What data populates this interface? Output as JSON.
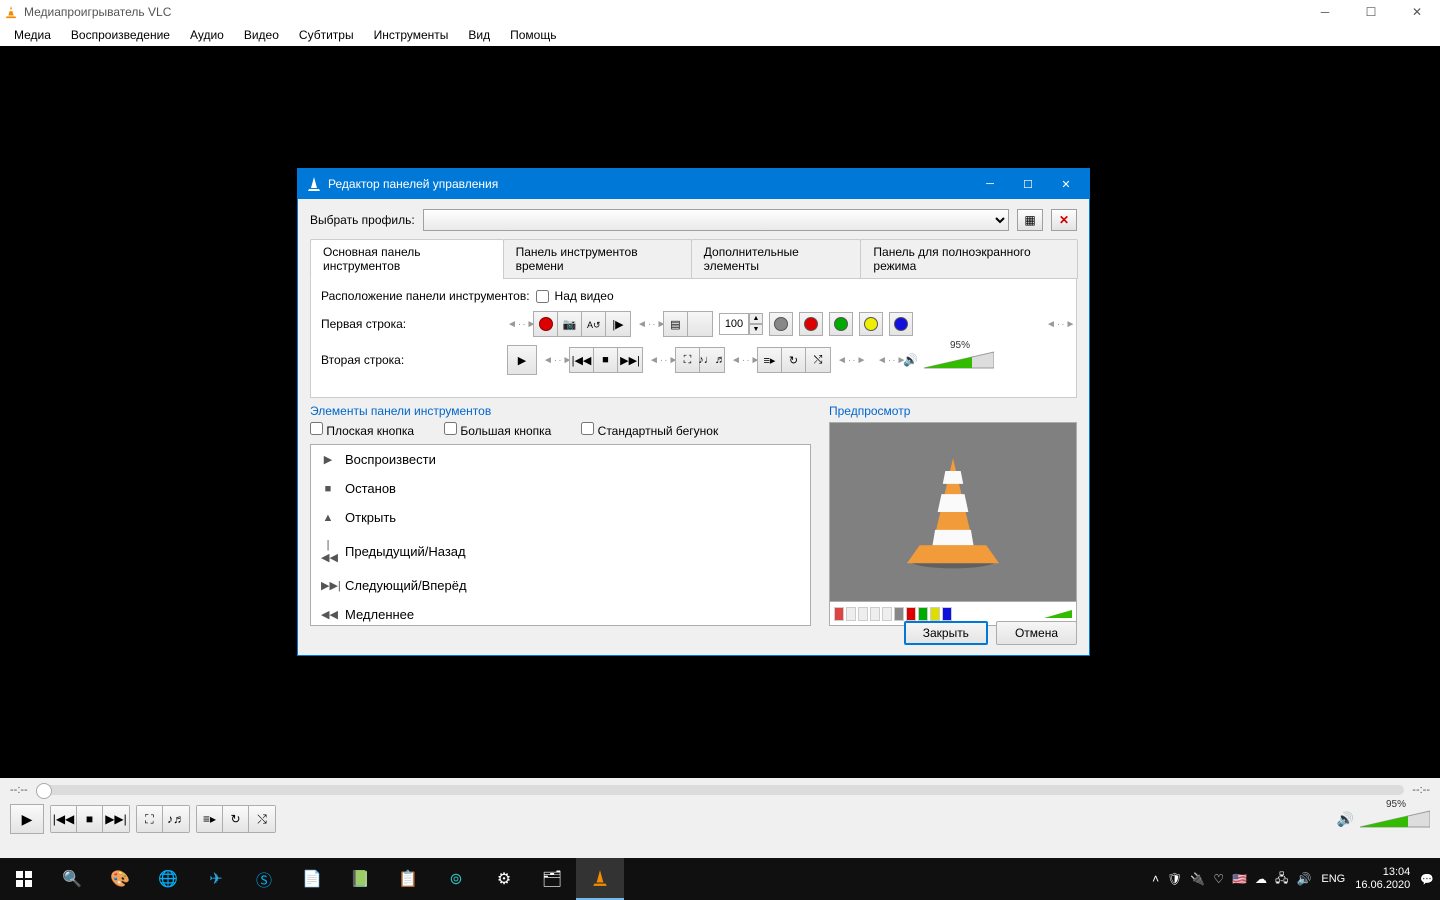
{
  "window": {
    "title": "Медиапроигрыватель VLC"
  },
  "menu": [
    "Медиа",
    "Воспроизведение",
    "Аудио",
    "Видео",
    "Субтитры",
    "Инструменты",
    "Вид",
    "Помощь"
  ],
  "dialog": {
    "title": "Редактор панелей управления",
    "profile_label": "Выбрать профиль:",
    "tabs": [
      "Основная панель инструментов",
      "Панель инструментов времени",
      "Дополнительные элементы",
      "Панель для полноэкранного режима"
    ],
    "position_label": "Расположение панели инструментов:",
    "above_video": "Над видео",
    "row1_label": "Первая строка:",
    "row2_label": "Вторая строка:",
    "spin_value": "100",
    "volume_pct": "95%",
    "elements_label": "Элементы панели инструментов",
    "flat_button": "Плоская кнопка",
    "big_button": "Большая кнопка",
    "std_slider": "Стандартный бегунок",
    "items": [
      "Воспроизвести",
      "Останов",
      "Открыть",
      "Предыдущий/Назад",
      "Следующий/Вперёд",
      "Медленнее"
    ],
    "item_icons": [
      "▶",
      "■",
      "▲",
      "|◀◀",
      "▶▶|",
      "◀◀"
    ],
    "preview_label": "Предпросмотр",
    "close": "Закрыть",
    "cancel": "Отмена"
  },
  "main_controls": {
    "time_left": "--:--",
    "time_right": "--:--",
    "volume_pct": "95%"
  },
  "taskbar": {
    "lang": "ENG",
    "time": "13:04",
    "date": "16.06.2020"
  }
}
